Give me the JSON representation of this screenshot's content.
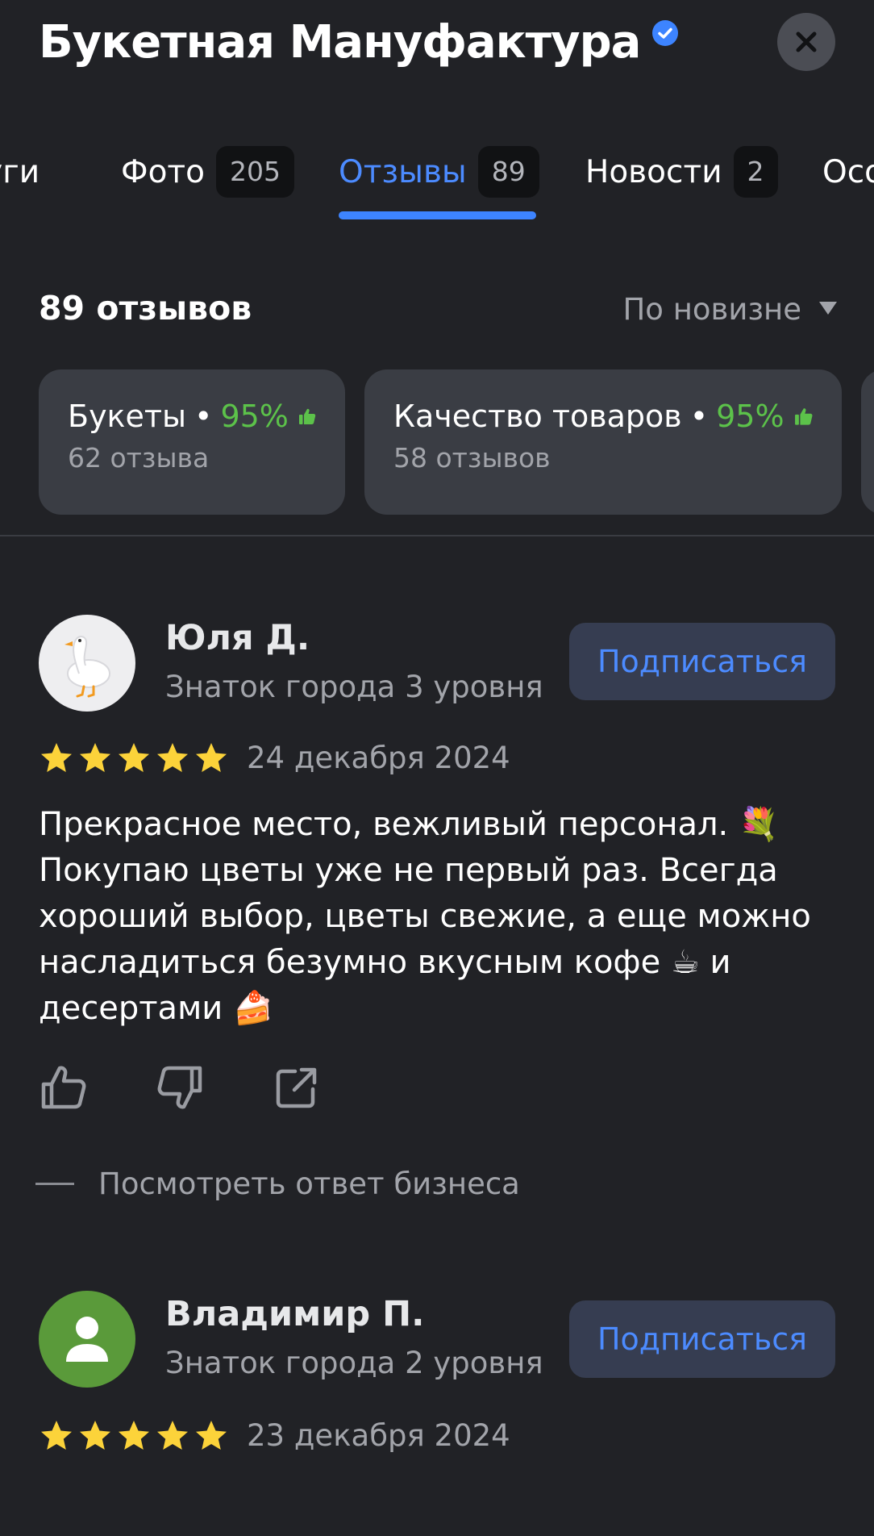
{
  "header": {
    "title": "Букетная Мануфактура",
    "verified": true
  },
  "tabs": [
    {
      "label": "Услуги",
      "count": null
    },
    {
      "label": "Фото",
      "count": "205"
    },
    {
      "label": "Отзывы",
      "count": "89",
      "active": true
    },
    {
      "label": "Новости",
      "count": "2"
    },
    {
      "label": "Особенности",
      "count": null
    }
  ],
  "reviews_summary": {
    "count_label": "89 отзывов",
    "sort_label": "По новизне"
  },
  "aspects": [
    {
      "name": "Букеты",
      "percent": "95%",
      "reviews": "62 отзыва"
    },
    {
      "name": "Качество товаров",
      "percent": "95%",
      "reviews": "58 отзывов"
    }
  ],
  "reviews": [
    {
      "author": "Юля Д.",
      "level": "Знаток города 3 уровня",
      "subscribe_label": "Подписаться",
      "rating": 5,
      "date": "24 декабря 2024",
      "text": "Прекрасное место, вежливый персонал. 💐 Покупаю цветы уже не первый раз. Всегда хороший выбор, цветы свежие, а еще можно насладиться безумно вкусным кофе ☕ и десертами 🍰",
      "business_reply_label": "Посмотреть ответ бизнеса"
    },
    {
      "author": "Владимир П.",
      "level": "Знаток города 2 уровня",
      "subscribe_label": "Подписаться",
      "rating": 5,
      "date": "23 декабря 2024"
    }
  ],
  "colors": {
    "background": "#212226",
    "accent": "#4c8bff",
    "positive": "#5cc24a",
    "star": "#fcd33a",
    "avatar_green": "#5a9a3a"
  }
}
